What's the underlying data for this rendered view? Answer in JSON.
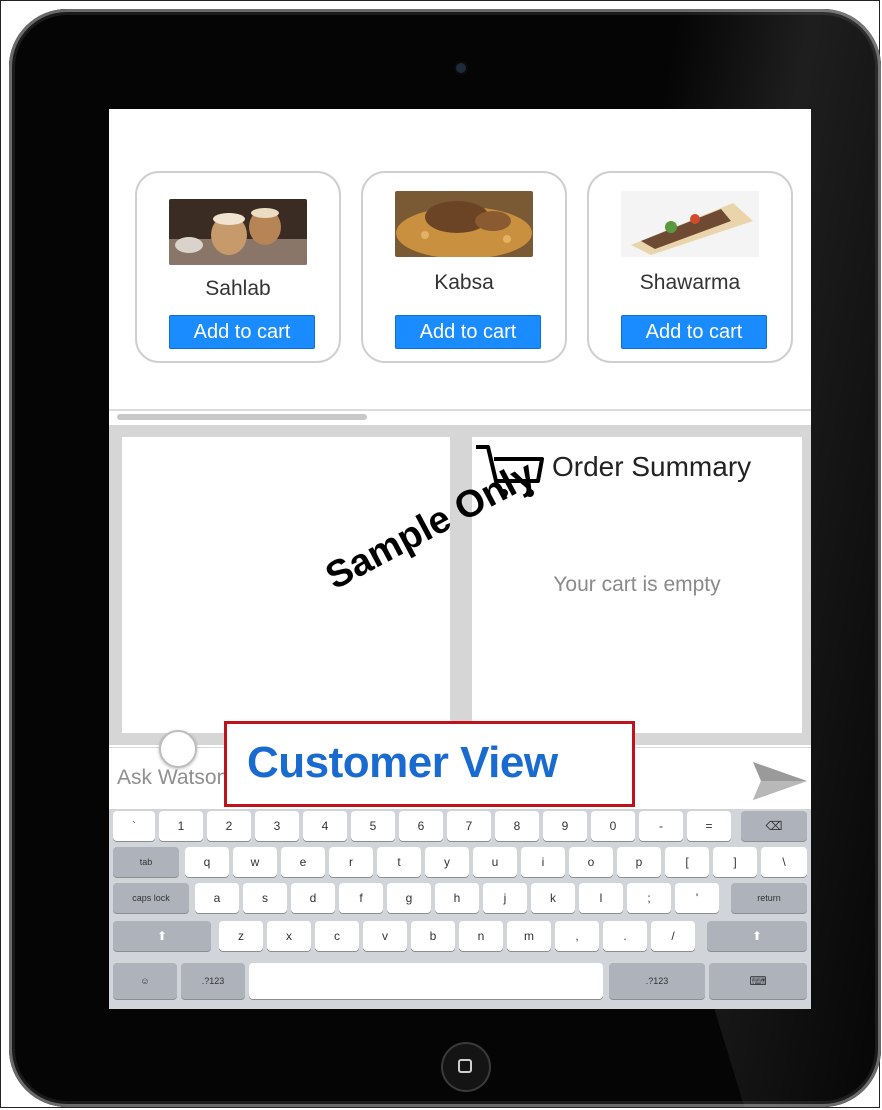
{
  "menu": {
    "items": [
      {
        "name": "Sahlab",
        "button": "Add to cart"
      },
      {
        "name": "Kabsa",
        "button": "Add to cart"
      },
      {
        "name": "Shawarma",
        "button": "Add to cart"
      }
    ]
  },
  "order_summary": {
    "title": "Order Summary",
    "empty_message": "Your cart is empty",
    "icon": "shopping-cart-icon"
  },
  "chat_input": {
    "placeholder": "Ask Watson",
    "send_icon": "send-icon"
  },
  "keyboard": {
    "row1": [
      "`",
      "1",
      "2",
      "3",
      "4",
      "5",
      "6",
      "7",
      "8",
      "9",
      "0",
      "-",
      "=",
      "⌫"
    ],
    "row2": [
      "tab",
      "q",
      "w",
      "e",
      "r",
      "t",
      "y",
      "u",
      "i",
      "o",
      "p",
      "[",
      "]",
      "\\"
    ],
    "row3": [
      "caps lock",
      "a",
      "s",
      "d",
      "f",
      "g",
      "h",
      "j",
      "k",
      "l",
      ";",
      "'",
      "return"
    ],
    "row4": [
      "⬆",
      "z",
      "x",
      "c",
      "v",
      "b",
      "n",
      "m",
      ",",
      ".",
      "/",
      "⬆"
    ],
    "row5": [
      "☺",
      ".?123",
      "",
      ".?123",
      "⌨"
    ]
  },
  "overlays": {
    "watermark": "Sample Only",
    "view_label": "Customer View"
  },
  "colors": {
    "button_blue": "#1a8cff",
    "view_label_blue": "#1a6bd0",
    "highlight_red": "#c0121b"
  }
}
